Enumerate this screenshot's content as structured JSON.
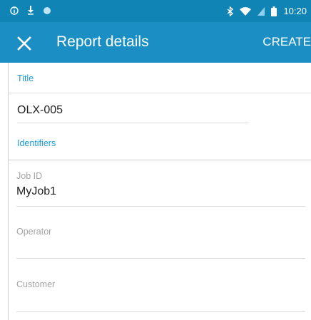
{
  "status_bar": {
    "time": "10:20",
    "icons": [
      "info-icon",
      "download-icon",
      "notification-dot-icon",
      "bluetooth-icon",
      "wifi-icon",
      "signal-icon",
      "battery-icon"
    ]
  },
  "app_bar": {
    "title": "Report details",
    "action_label": "CREATE",
    "close_icon": "close-icon"
  },
  "form": {
    "title_section": {
      "label": "Title",
      "value": "OLX-005"
    },
    "identifiers_section": {
      "label": "Identifiers",
      "fields": [
        {
          "label": "Job ID",
          "value": "MyJob1"
        },
        {
          "label": "Operator",
          "value": ""
        },
        {
          "label": "Customer",
          "value": ""
        }
      ]
    }
  },
  "colors": {
    "app_bar": "#1b8fc3",
    "status_bar": "#0f84b5",
    "accent": "#1b9bd6"
  }
}
